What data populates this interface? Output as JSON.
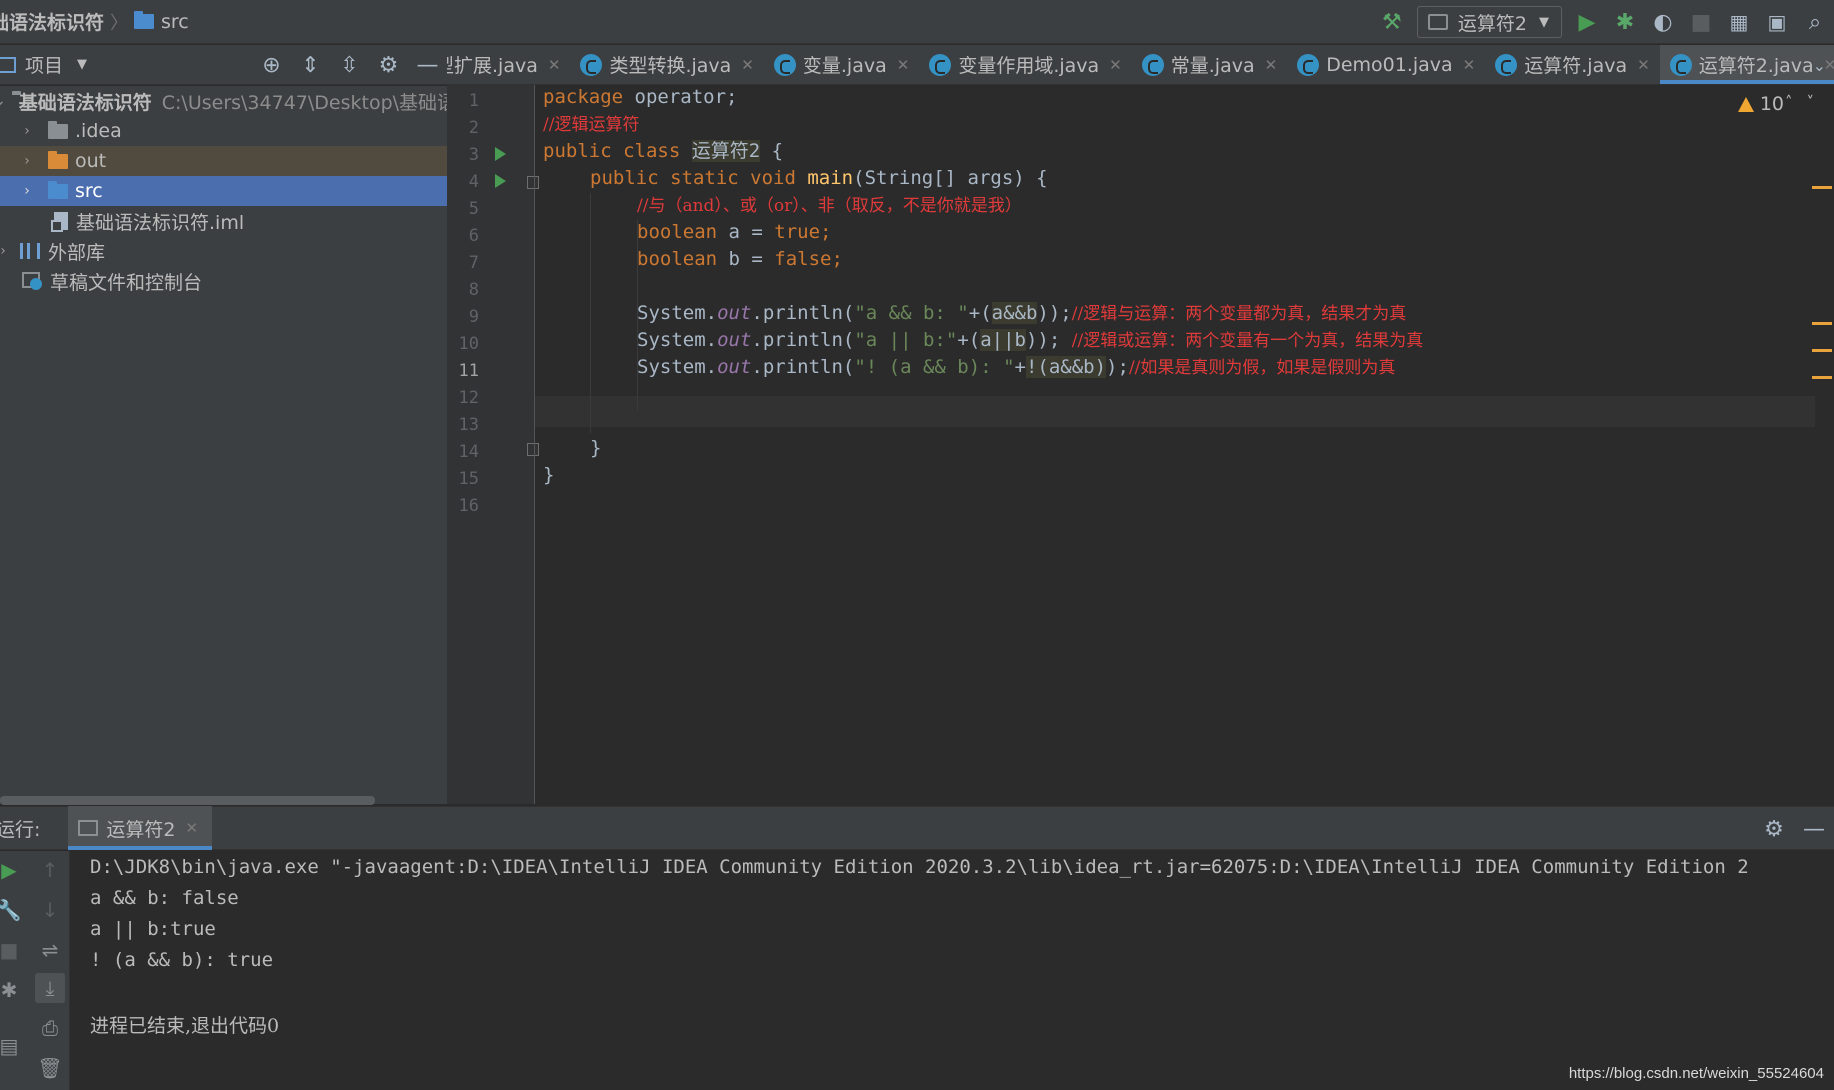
{
  "navbar": {
    "project": "础语法标识符",
    "folder": "src",
    "run_config": "运算符2"
  },
  "project_panel": {
    "title": "项目",
    "root": {
      "name": "基础语法标识符",
      "path": "C:\\Users\\34747\\Desktop\\基础语"
    },
    "items": [
      {
        "label": ".idea"
      },
      {
        "label": "out"
      },
      {
        "label": "src"
      },
      {
        "label": "基础语法标识符.iml"
      },
      {
        "label": "外部库"
      },
      {
        "label": "草稿文件和控制台"
      }
    ]
  },
  "tabs": [
    {
      "label": "型扩展.java"
    },
    {
      "label": "类型转换.java"
    },
    {
      "label": "变量.java"
    },
    {
      "label": "变量作用域.java"
    },
    {
      "label": "常量.java"
    },
    {
      "label": "Demo01.java"
    },
    {
      "label": "运算符.java"
    },
    {
      "label": "运算符2.java",
      "active": true
    }
  ],
  "editor": {
    "warnings": "10",
    "current_line": 11,
    "line_numbers": [
      "1",
      "2",
      "3",
      "4",
      "5",
      "6",
      "7",
      "8",
      "9",
      "10",
      "11",
      "12",
      "13",
      "14",
      "15",
      "16"
    ],
    "lines": {
      "l1_kw": "package",
      "l1_rest": " operator;",
      "l2_cmt": "//逻辑运算符",
      "l3_kw": "public class",
      "l3_cls": "运算符2",
      "l3_rest": " {",
      "l4_kw": "public static void",
      "l4_fn": "main",
      "l4_rest": "(String[] args) {",
      "l5_cmt": "//与（and）、或（or）、非（取反，不是你就是我）",
      "l6_kw": "boolean",
      "l6_rest": " a = ",
      "l6_val": "true",
      "l6_end": ";",
      "l7_kw": "boolean",
      "l7_rest": " b = ",
      "l7_val": "false",
      "l7_end": ";",
      "l9_a": "System.",
      "l9_out": "out",
      "l9_b": ".println(",
      "l9_str": "\"a && b: \"",
      "l9_c": "+(",
      "l9_hl": "a&&b",
      "l9_d": "));",
      "l9_cmt": "//逻辑与运算：两个变量都为真，结果才为真",
      "l10_a": "System.",
      "l10_out": "out",
      "l10_b": ".println(",
      "l10_str": "\"a || b:\"",
      "l10_c": "+(",
      "l10_hl": "a||b",
      "l10_d": ")); ",
      "l10_cmt": "//逻辑或运算：两个变量有一个为真，结果为真",
      "l11_a": "System.",
      "l11_out": "out",
      "l11_b": ".println(",
      "l11_str": "\"! (a && b): \"",
      "l11_c": "+",
      "l11_hl": "!(a&&b)",
      "l11_d": ");",
      "l11_cmt": "//如果是真则为假，如果是假则为真",
      "l14": "}",
      "l15": "}"
    }
  },
  "run_panel": {
    "label": "运行:",
    "tab": "运算符2",
    "output": [
      "D:\\JDK8\\bin\\java.exe \"-javaagent:D:\\IDEA\\IntelliJ IDEA Community Edition 2020.3.2\\lib\\idea_rt.jar=62075:D:\\IDEA\\IntelliJ IDEA Community Edition 2",
      "a && b: false",
      "a || b:true",
      "! (a && b): true",
      "",
      "进程已结束,退出代码0"
    ],
    "watermark": "https://blog.csdn.net/weixin_55524604"
  },
  "colors": {
    "keyword": "#cc7832",
    "string": "#6a8759",
    "comment": "#e03a3a",
    "selection": "#4b6eaf",
    "run_green": "#499c54"
  }
}
